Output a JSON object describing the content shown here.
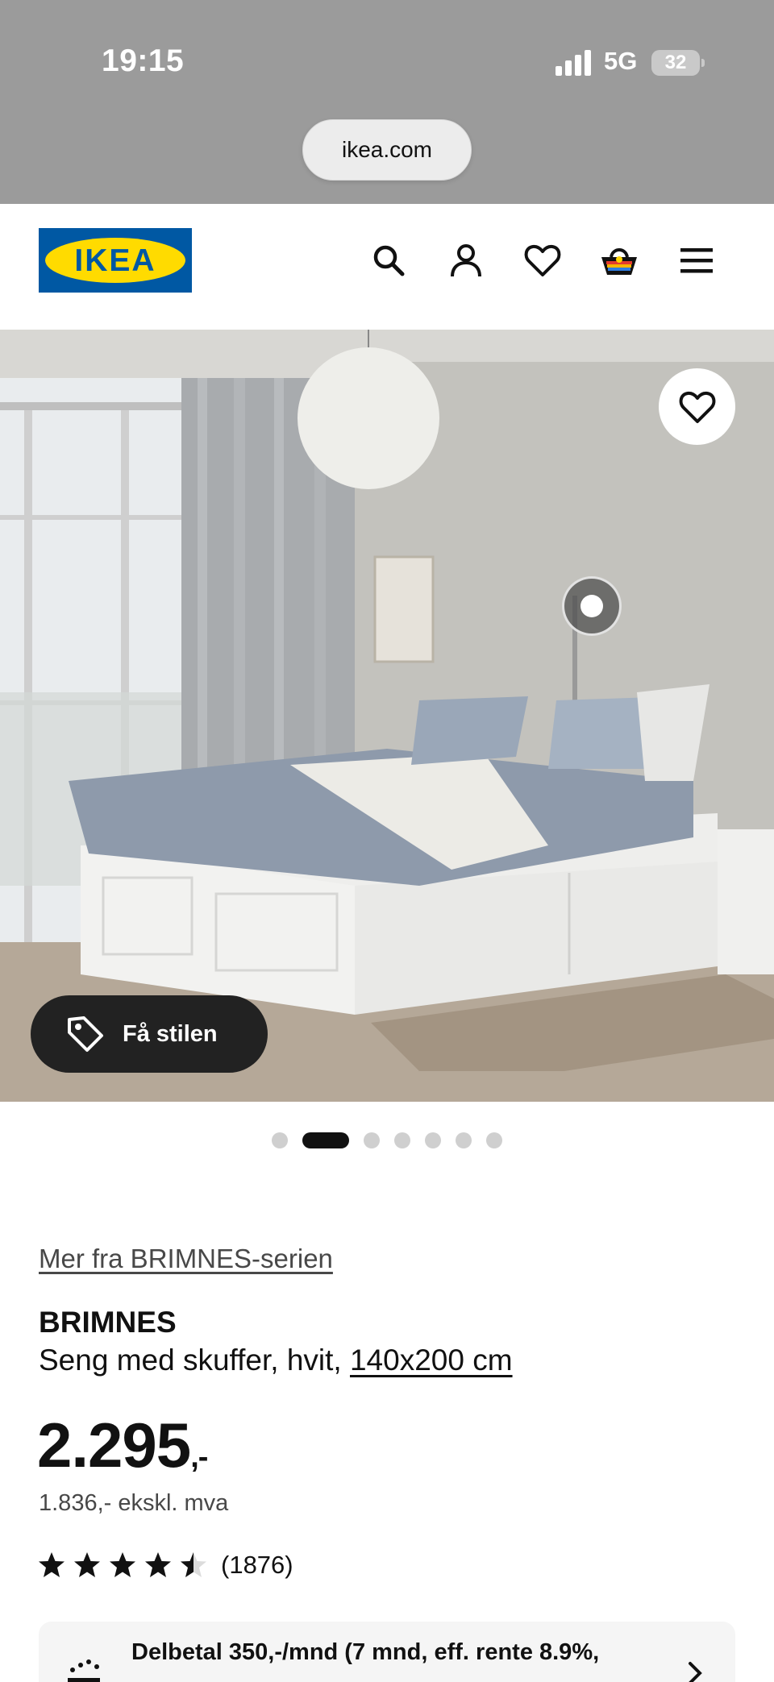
{
  "status_bar": {
    "time": "19:15",
    "network": "5G",
    "battery": "32"
  },
  "browser": {
    "url": "ikea.com"
  },
  "header": {
    "logo_text": "IKEA",
    "icons": [
      "search-icon",
      "account-icon",
      "heart-icon",
      "basket-icon",
      "menu-icon"
    ]
  },
  "hero": {
    "style_button_label": "Få stilen",
    "active_slide": 2,
    "slide_count": 7
  },
  "product": {
    "series_link": "Mer fra BRIMNES-serien",
    "name": "BRIMNES",
    "description": "Seng med skuffer, hvit, ",
    "size": "140x200 cm",
    "price": "2.295",
    "price_suffix": ",-",
    "price_ex_vat": "1.836,- ekskl. mva",
    "rating": 4.5,
    "review_count": "(1876)"
  },
  "finance": {
    "text": "Delbetal 350,-/mnd (7 mnd, eff. rente 8.9%,"
  },
  "colors": {
    "ikea_blue": "#0058a3",
    "ikea_yellow": "#ffdb00",
    "status_bar_gray": "#9b9b9b"
  }
}
